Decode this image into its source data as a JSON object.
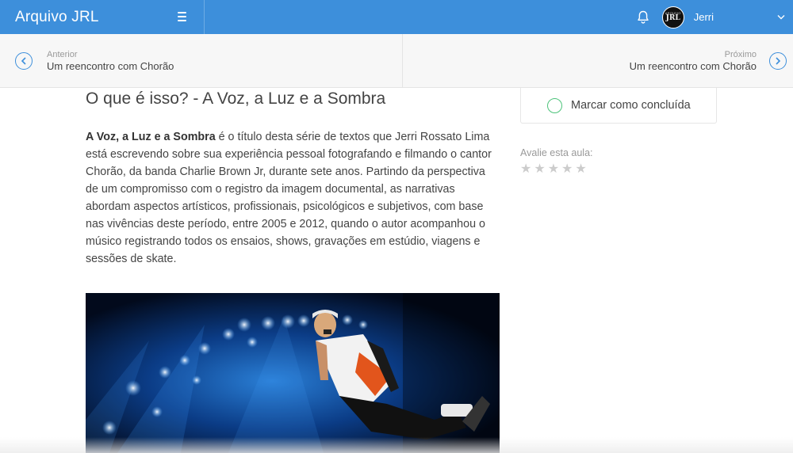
{
  "header": {
    "title": "Arquivo JRL",
    "menu_icon": "hamburger-icon",
    "notification_icon": "bell-icon",
    "user": {
      "avatar_small": "ARQUIVO",
      "avatar_logo": "JRL",
      "name": "Jerri"
    },
    "accent_color": "#3d8fdb"
  },
  "lesson_nav": {
    "prev_label": "Anterior",
    "prev_title": "Um reencontro com Chorão",
    "next_label": "Próximo",
    "next_title": "Um reencontro com Chorão"
  },
  "lesson": {
    "title": "O que é isso? - A Voz, a Luz e a Sombra",
    "intro_bold": "A Voz, a Luz e a Sombra",
    "intro_text": " é o título desta série de textos que Jerri Rossato Lima está escrevendo sobre sua experiência pessoal fotografando e filmando o cantor Chorão, da banda Charlie Brown Jr, durante sete anos. Partindo da perspectiva de um compromisso com o registro da imagem documental, as narrativas abordam aspectos artísticos, profissionais, psicológicos e subjetivos, com base nas vivências deste período, entre 2005 e 2012, quando o autor acompanhou o músico registrando todos os ensaios, shows, gravações em estúdio, viagens e sessões de skate."
  },
  "sidebar": {
    "complete_label": "Marcar como concluída",
    "rate_label": "Avalie esta aula:",
    "rating": 0,
    "max_rating": 5
  }
}
